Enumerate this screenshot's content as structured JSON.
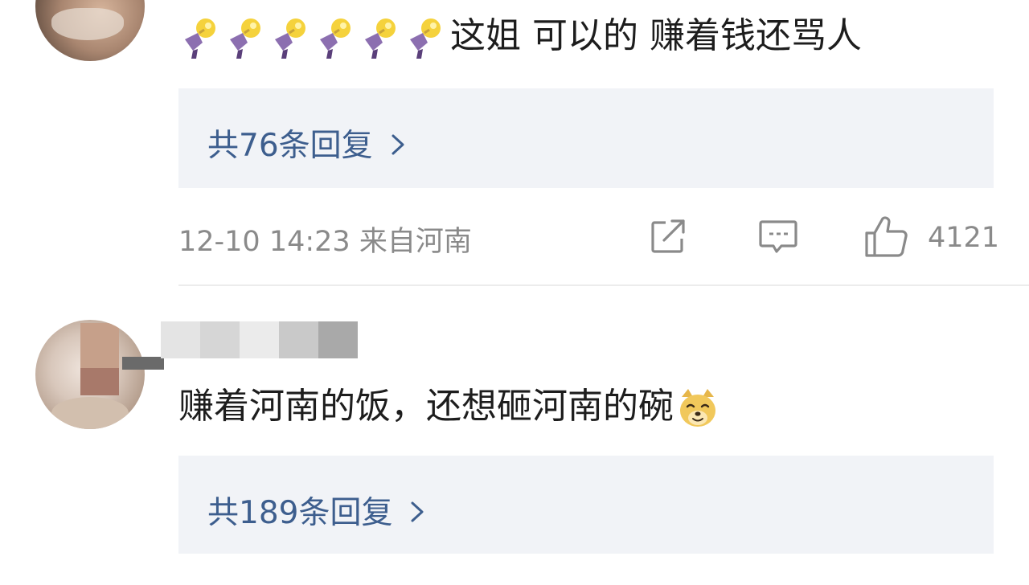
{
  "comments": [
    {
      "text": "这姐 可以的 赚着钱还骂人",
      "emoji": "bulb-emoji",
      "emoji_count": 6,
      "replies_label": "共76条回复",
      "meta": "12-10 14:23 来自河南",
      "like_count": "4121"
    },
    {
      "text": "赚着河南的饭，还想砸河南的碗",
      "emoji": "doge-emoji",
      "replies_label": "共189条回复"
    }
  ],
  "icons": {
    "chevron": "chevron-right-icon",
    "share": "share-icon",
    "comment": "comment-icon",
    "like": "thumbs-up-icon"
  },
  "colors": {
    "link": "#3d5e8e",
    "reply_bg": "#f1f3f7",
    "meta": "#8a8a8a"
  }
}
